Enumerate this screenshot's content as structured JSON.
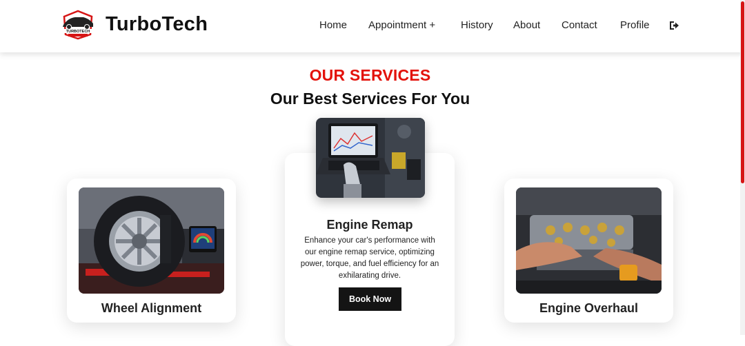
{
  "brand": {
    "name": "TurboTech",
    "logo_text": "TURBOTECH"
  },
  "nav": {
    "items": [
      {
        "label": "Home"
      },
      {
        "label": "Appointment +"
      },
      {
        "label": "History"
      },
      {
        "label": "About"
      },
      {
        "label": "Contact"
      },
      {
        "label": "Profile"
      }
    ],
    "logout_icon": "sign-out-icon"
  },
  "section": {
    "eyebrow": "OUR SERVICES",
    "title": "Our Best Services For You"
  },
  "services": [
    {
      "title": "Wheel Alignment",
      "image": "wheel-alignment-photo"
    },
    {
      "title": "Engine Remap",
      "image": "engine-remap-laptop-photo",
      "description": "Enhance your car's performance with our engine remap service, optimizing power, torque, and fuel efficiency for an exhilarating drive.",
      "button": "Book Now"
    },
    {
      "title": "Engine Overhaul",
      "image": "engine-overhaul-photo"
    }
  ],
  "colors": {
    "accent": "#e3120b",
    "button": "#141414"
  }
}
